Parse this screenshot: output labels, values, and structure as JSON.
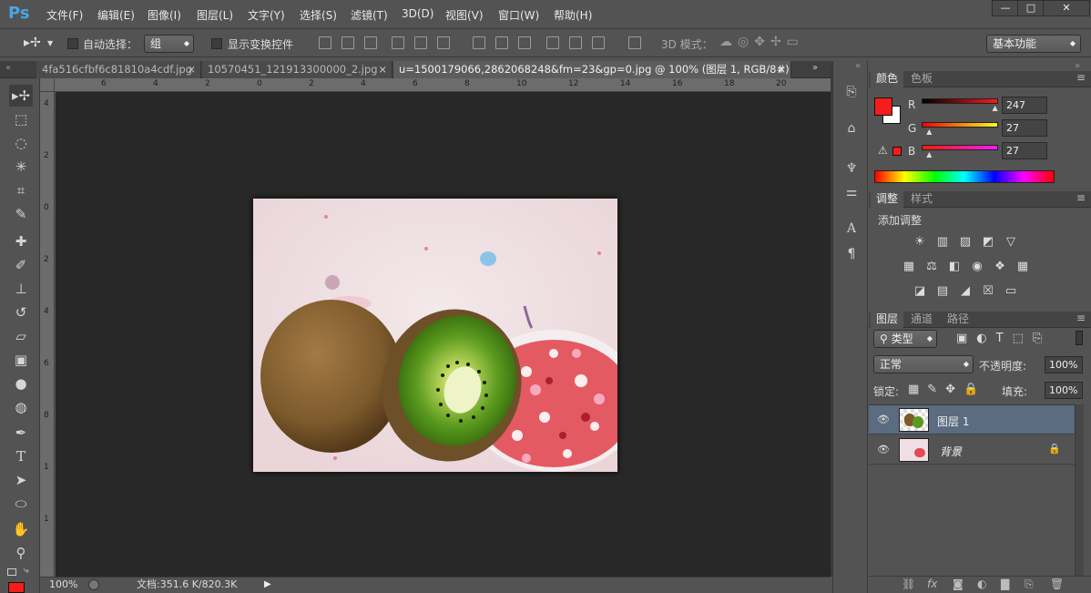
{
  "app": {
    "logo": "Ps"
  },
  "menu": [
    "文件(F)",
    "编辑(E)",
    "图像(I)",
    "图层(L)",
    "文字(Y)",
    "选择(S)",
    "滤镜(T)",
    "3D(D)",
    "视图(V)",
    "窗口(W)",
    "帮助(H)"
  ],
  "window_controls": {
    "minimize": "—",
    "maximize": "□",
    "close": "✕"
  },
  "options": {
    "auto_select_label": "自动选择：",
    "auto_select_value": "组",
    "show_transform_label": "显示变换控件",
    "mode_3d_label": "3D 模式：",
    "workspace": "基本功能"
  },
  "tabs": [
    {
      "label": "4fa516cfbf6c81810a4cdf.jpg",
      "close": "×"
    },
    {
      "label": "10570451_121913300000_2.jpg",
      "close": "×"
    },
    {
      "label": "u=1500179066,2862068248&fm=23&gp=0.jpg @ 100% (图层 1, RGB/8#) *",
      "close": "×"
    }
  ],
  "hruler_labels": [
    "6",
    "4",
    "2",
    "0",
    "2",
    "4",
    "6",
    "8",
    "10",
    "12",
    "14",
    "16",
    "18",
    "20"
  ],
  "vruler_labels": [
    "4",
    "2",
    "0",
    "2",
    "4",
    "6",
    "8",
    "1",
    "1"
  ],
  "status": {
    "zoom": "100%",
    "doc_size": "文档:351.6 K/820.3K"
  },
  "color_panel": {
    "tabs": [
      "颜色",
      "色板"
    ],
    "channels": [
      {
        "label": "R",
        "value": "247",
        "fraction": 0.97
      },
      {
        "label": "G",
        "value": "27",
        "fraction": 0.11
      },
      {
        "label": "B",
        "value": "27",
        "fraction": 0.11
      }
    ],
    "fg_color": "#f71b1b",
    "bg_color": "#ffffff"
  },
  "adjust_panel": {
    "tabs": [
      "调整",
      "样式"
    ],
    "title": "添加调整"
  },
  "layers_panel": {
    "tabs": [
      "图层",
      "通道",
      "路径"
    ],
    "filter_type": "类型",
    "blend_mode": "正常",
    "opacity_label": "不透明度:",
    "opacity_value": "100%",
    "lock_label": "锁定:",
    "fill_label": "填充:",
    "fill_value": "100%",
    "layers": [
      {
        "name": "图层 1",
        "selected": true,
        "locked": false
      },
      {
        "name": "背景",
        "selected": false,
        "locked": true
      }
    ]
  },
  "tools": [
    "move-icon",
    "marquee-icon",
    "lasso-icon",
    "magic-wand-icon",
    "crop-icon",
    "eyedropper-icon",
    "healing-brush-icon",
    "brush-icon",
    "stamp-icon",
    "history-brush-icon",
    "eraser-icon",
    "gradient-icon",
    "blur-icon",
    "dodge-icon",
    "pen-icon",
    "type-icon",
    "path-select-icon",
    "ellipse-icon",
    "hand-icon",
    "zoom-icon"
  ]
}
